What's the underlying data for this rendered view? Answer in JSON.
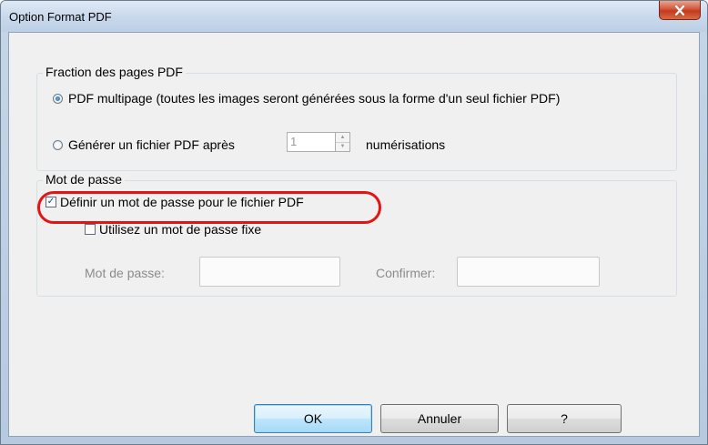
{
  "window": {
    "title": "Option Format PDF",
    "close_icon": "close-x-icon"
  },
  "fraction_group": {
    "legend": "Fraction des pages PDF",
    "multipage_label": "PDF multipage (toutes les images seront générées sous la forme d'un seul fichier PDF)",
    "multipage_selected": true,
    "generate_label": "Générer un fichier PDF après",
    "generate_selected": false,
    "count_value": "1",
    "count_suffix": "numérisations"
  },
  "password_group": {
    "legend": "Mot de passe",
    "define_label": "Définir un mot de passe pour le fichier PDF",
    "define_checked": true,
    "fixed_label": "Utilisez un mot de passe fixe",
    "fixed_checked": false,
    "password_label": "Mot de passe:",
    "confirm_label": "Confirmer:",
    "password_value": "",
    "confirm_value": ""
  },
  "buttons": {
    "ok": "OK",
    "cancel": "Annuler",
    "help": "?"
  },
  "colors": {
    "highlight": "#e21414",
    "default_button_border": "#3c7fb1"
  }
}
